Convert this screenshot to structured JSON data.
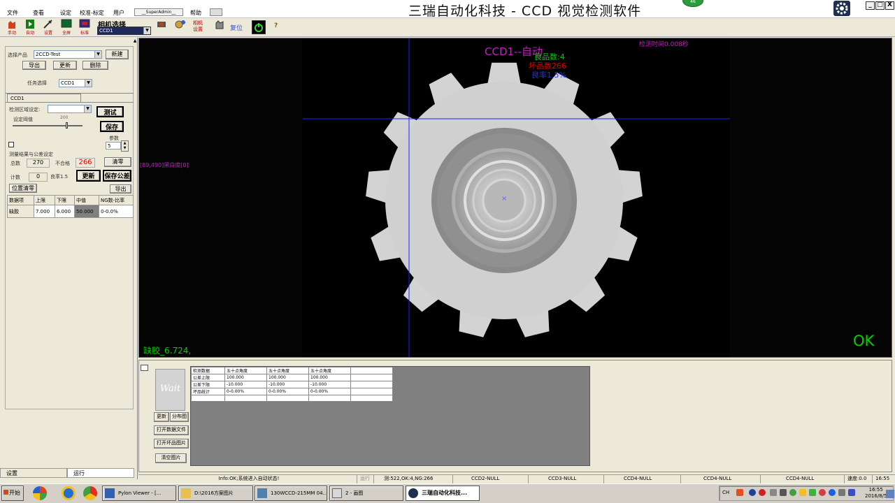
{
  "menu": {
    "items": [
      "文件",
      "查看",
      "设定",
      "校准-标定",
      "用户",
      "帮助"
    ],
    "user": "__SuperAdmin__"
  },
  "window": {
    "title": "三瑞自动化科技 - CCD 视觉检测软件",
    "badge": "46",
    "min": "_",
    "max": "□",
    "close": "X"
  },
  "toolbar": {
    "manual": "手动",
    "auto": "自动",
    "settings": "设置",
    "fullscreen": "全屏",
    "calibrate": "标准",
    "camera_select_label": "相机选择",
    "camera_value": "CCD1",
    "camera_setting": "相机\n设置",
    "reset": "复位",
    "help": "?"
  },
  "left": {
    "product_label": "选择产品",
    "product_value": "2CCD-Test",
    "new_btn": "新建",
    "export_btn": "导出",
    "update_btn": "更新",
    "delete_btn": "删除",
    "task_label": "任务选择",
    "task_value": "CCD1",
    "tab_label": "CCD1",
    "region_label": "检测区域设定:",
    "test_btn": "测试",
    "threshold_label": "设定阈值",
    "threshold_value": "200",
    "save_btn": "保存",
    "param_label": "参数",
    "param_value": "5",
    "group_label": "测量结果与公差设定",
    "total_label": "总数",
    "total_value": "270",
    "ng_label": "不合格",
    "ng_value": "266",
    "clear_btn": "清零",
    "count_label": "计数",
    "count_value": "0",
    "yield_label": "良率1.5",
    "refresh_btn": "更新",
    "save_tol_btn": "保存公差",
    "pos_clear_btn": "位置清零",
    "export2_btn": "导出",
    "table": {
      "headers": [
        "数据项",
        "上限",
        "下限",
        "中值",
        "NG数-比率"
      ],
      "row": [
        "缺胶",
        "7.000",
        "6.000",
        "50.000",
        "0-0.0%"
      ]
    }
  },
  "camera": {
    "mode": "CCD1--自动",
    "good": "良品数:4",
    "bad": "坏品数266",
    "rate": "良率1.5%",
    "time": "检测时间0.008秒",
    "pixel": "[89,490]黑白度[0]",
    "measure": "缺胶_6.724,",
    "result": "OK",
    "center_mark": "×"
  },
  "bottom": {
    "wait": "Wait",
    "refresh_btn": "更新",
    "dist_btn": "分布图",
    "open_data_btn": "打开数据文件",
    "open_bad_btn": "打开坏品图片",
    "clear_img_btn": "清空图片",
    "stats": [
      [
        "检测数据",
        "五十点角度",
        "五十点角度",
        "五十点角度",
        ""
      ],
      [
        "公差上限",
        "100.000",
        "100.000",
        "100.000",
        ""
      ],
      [
        "公差下限",
        "-10.000",
        "-10.000",
        "-10.000",
        ""
      ],
      [
        "坏品统计",
        "0-0.00%",
        "0-0.00%",
        "0-0.00%",
        ""
      ],
      [
        "",
        "",
        "",
        "",
        ""
      ]
    ]
  },
  "tabs": {
    "settings": "设置",
    "run": "运行"
  },
  "status": {
    "info": "Info:OK;系统进入自动状态!",
    "run": "运行",
    "counts": "测:522,OK:4,NG:266",
    "ccd2": "CCD2-NULL",
    "ccd3": "CCD3-NULL",
    "ccd4a": "CCD4-NULL",
    "ccd4b": "CCD4-NULL",
    "ccd4c": "CCD4-NULL",
    "speed": "速度:0.0",
    "clock": "16:55"
  },
  "taskbar": {
    "start": "开始",
    "tasks": [
      "Pylon Viewer - [...",
      "D:\\2016方案图片",
      "130WCCD-215MM 04...",
      "2 - 画图",
      "三瑞自动化科技..."
    ],
    "tray_lang": "CH",
    "time": "16:55",
    "date": "2016/8/5"
  },
  "colors": {
    "accent": "#3a4fc4",
    "ok": "#00d000",
    "ng": "#e00000",
    "magenta": "#c020c0"
  }
}
